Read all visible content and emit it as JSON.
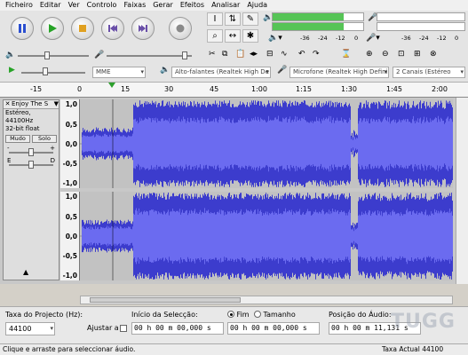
{
  "menu": [
    "Ficheiro",
    "Editar",
    "Ver",
    "Controlo",
    "Faixas",
    "Gerar",
    "Efeitos",
    "Analisar",
    "Ajuda"
  ],
  "meters": {
    "play_scale": [
      "-36",
      "-24",
      "-12",
      "0"
    ],
    "rec_scale": [
      "-36",
      "-24",
      "-12",
      "0"
    ]
  },
  "device": {
    "host": "MME",
    "output": "Alto-falantes (Realtek High De",
    "input": "Microfone (Realtek High Defini",
    "channels": "2 Canais (Estéreo"
  },
  "ruler": [
    "-15",
    "0",
    "15",
    "30",
    "45",
    "1:00",
    "1:15",
    "1:30",
    "1:45",
    "2:00"
  ],
  "track": {
    "name": "Enjoy The S",
    "info1": "Estéreo, 44100Hz",
    "info2": "32-bit float",
    "mute": "Mudo",
    "solo": "Solo",
    "gain_min": "-",
    "gain_max": "+",
    "pan_left": "E",
    "pan_right": "D"
  },
  "scale_labels": [
    "1,0",
    "0,5",
    "0,0",
    "-0,5",
    "-1,0"
  ],
  "selection": {
    "rate_label": "Taxa do Projecto (Hz):",
    "rate_value": "44100",
    "snap_label": "Ajustar a",
    "start_label": "Início da Selecção:",
    "end_label": "Fim",
    "length_label": "Tamanho",
    "pos_label": "Posição do Áudio:",
    "start_value": "00 h 00 m 00,000 s",
    "end_value": "00 h 00 m 00,000 s",
    "pos_value": "00 h 00 m 11,131 s"
  },
  "status": {
    "hint": "Clique e arraste para seleccionar áudio.",
    "rate": "Taxa Actual 44100"
  },
  "watermark": "TUGG",
  "colors": {
    "waveform": "#3c3ccd",
    "background": "#c2c2c2",
    "meter": "#56c456"
  }
}
